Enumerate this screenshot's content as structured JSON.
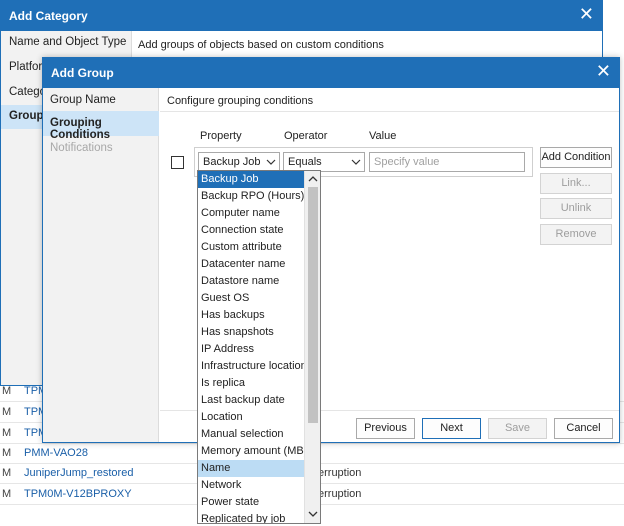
{
  "background_rows": [
    {
      "prefix": "M",
      "link": "TPM",
      "extra": ""
    },
    {
      "prefix": "M",
      "link": "TPM",
      "extra": ""
    },
    {
      "prefix": "M",
      "link": "TPM",
      "extra": ""
    },
    {
      "prefix": "M",
      "link": "PMM-VAO28",
      "extra": ""
    },
    {
      "prefix": "M",
      "link": "JuniperJump_restored",
      "extra": "erruption"
    },
    {
      "prefix": "M",
      "link": "TPM0M-V12BPROXY",
      "extra": "erruption"
    }
  ],
  "add_category": {
    "title": "Add Category",
    "close": "✕",
    "description": "Add groups of objects based on custom conditions",
    "steps": [
      "Name and Object Type",
      "Platform",
      "Category",
      "Grouping"
    ]
  },
  "add_group": {
    "title": "Add Group",
    "close": "✕",
    "description": "Configure grouping conditions",
    "steps": [
      "Group Name",
      "Grouping Conditions",
      "Notifications"
    ],
    "columns": {
      "property": "Property",
      "operator": "Operator",
      "value": "Value"
    },
    "condition": {
      "property": "Backup Job",
      "operator": "Equals",
      "value_placeholder": "Specify value"
    },
    "side_buttons": {
      "add_condition": "Add Condition",
      "link": "Link...",
      "unlink": "Unlink",
      "remove": "Remove"
    },
    "footer_buttons": {
      "previous": "Previous",
      "next": "Next",
      "save": "Save",
      "cancel": "Cancel"
    }
  },
  "property_dropdown": {
    "options": [
      "Backup Job",
      "Backup RPO (Hours)",
      "Computer name",
      "Connection state",
      "Custom attribute",
      "Datacenter name",
      "Datastore name",
      "Guest OS",
      "Has backups",
      "Has snapshots",
      "IP Address",
      "Infrastructure location",
      "Is replica",
      "Last backup date",
      "Location",
      "Manual selection",
      "Memory amount (MB)",
      "Name",
      "Network",
      "Power state",
      "Replicated by job"
    ],
    "selected": "Backup Job",
    "hovered": "Name"
  },
  "colors": {
    "accent": "#1f6fb7",
    "selection": "#cde4f7",
    "hover": "#bcdcf4",
    "link": "#1a5fa8"
  }
}
